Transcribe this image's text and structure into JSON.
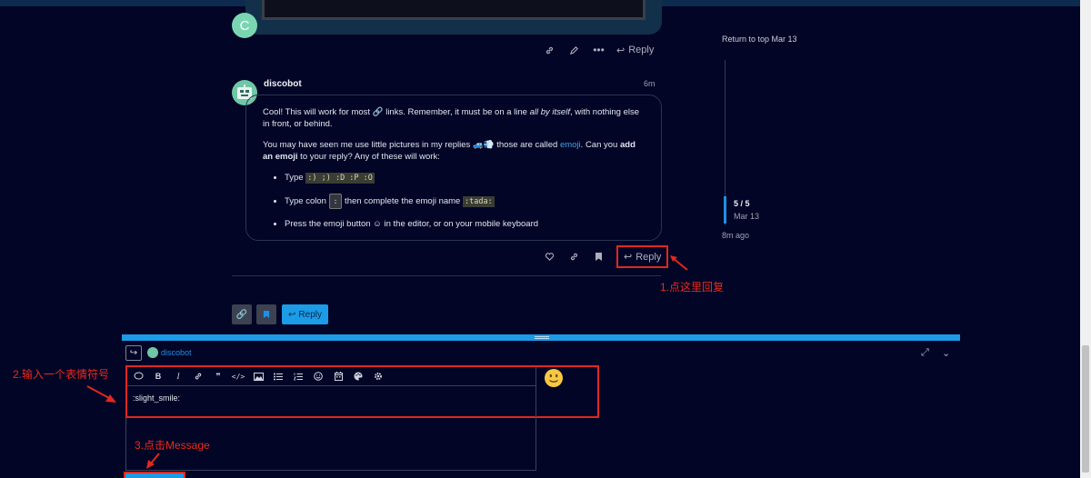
{
  "previous_post": {
    "avatar_letter": "C",
    "actions": {
      "reply_label": "Reply"
    }
  },
  "post": {
    "username": "discobot",
    "time": "6m",
    "paragraph1_a": "Cool! This will work for most ",
    "paragraph1_b": " links. Remember, it must be on a line ",
    "paragraph1_em": "all by itself",
    "paragraph1_c": ", with nothing else in front, or behind.",
    "paragraph2_a": "You may have seen me use little pictures in my replies ",
    "paragraph2_b": " those are called ",
    "paragraph2_link": "emoji",
    "paragraph2_c": ". Can you ",
    "paragraph2_strong": "add an emoji",
    "paragraph2_d": " to your reply? Any of these will work:",
    "bullet1_label": "Type ",
    "bullet1_code": ":) ;) :D :P :O",
    "bullet2_label": "Type colon ",
    "bullet2_kbd": ":",
    "bullet2_mid": " then complete the emoji name ",
    "bullet2_code": ":tada:",
    "bullet3": "Press the emoji button ☺ in the editor, or on your mobile keyboard",
    "actions": {
      "reply_label": "Reply"
    }
  },
  "timeline": {
    "return_to_top": "Return to top Mar 13",
    "count": "5 / 5",
    "date": "Mar 13",
    "ago": "8m ago"
  },
  "topic_footer": {
    "reply_label": "Reply"
  },
  "composer": {
    "reply_to": "discobot",
    "editor_text": ":slight_smile:",
    "toolbar_icons": [
      "quote-icon",
      "bold-icon",
      "italic-icon",
      "link-icon",
      "blockquote-icon",
      "code-icon",
      "image-icon",
      "bullet-list-icon",
      "numbered-list-icon",
      "emoji-icon",
      "calendar-icon",
      "palette-icon",
      "gear-icon"
    ]
  },
  "annotations": {
    "step1": "1.点这里回复",
    "step2": "2.输入一个表情符号",
    "step3": "3.点击Message"
  },
  "colors": {
    "accent": "#1c9be6",
    "annotation": "#e0281e",
    "background": "#020526"
  }
}
